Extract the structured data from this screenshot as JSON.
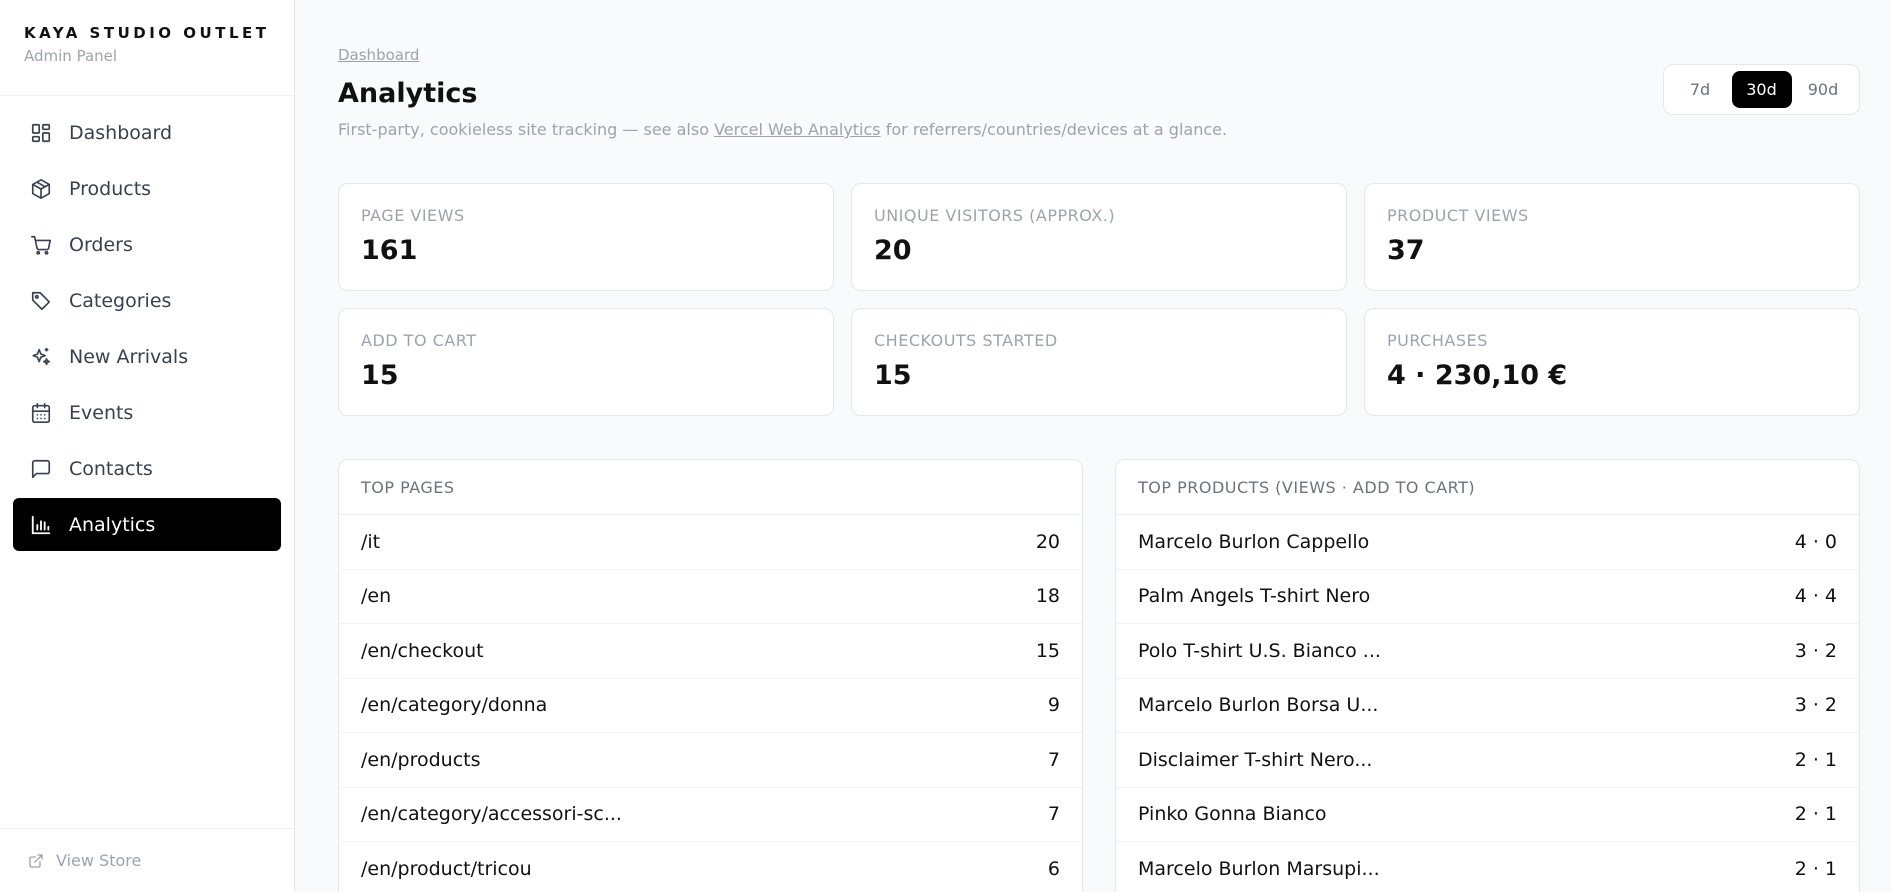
{
  "brand": {
    "title": "KAYA STUDIO OUTLET",
    "subtitle": "Admin Panel"
  },
  "nav": [
    {
      "label": "Dashboard",
      "icon": "dashboard-icon"
    },
    {
      "label": "Products",
      "icon": "box-icon"
    },
    {
      "label": "Orders",
      "icon": "cart-icon"
    },
    {
      "label": "Categories",
      "icon": "tag-icon"
    },
    {
      "label": "New Arrivals",
      "icon": "sparkles-icon"
    },
    {
      "label": "Events",
      "icon": "calendar-icon"
    },
    {
      "label": "Contacts",
      "icon": "message-icon"
    },
    {
      "label": "Analytics",
      "icon": "bar-chart-icon",
      "active": true
    }
  ],
  "footer": {
    "view_store": "View Store"
  },
  "header": {
    "breadcrumb": "Dashboard",
    "title": "Analytics",
    "subtitle_before": "First-party, cookieless site tracking — see also ",
    "subtitle_link": "Vercel Web Analytics",
    "subtitle_after": " for referrers/countries/devices at a glance."
  },
  "range": {
    "options": [
      "7d",
      "30d",
      "90d"
    ],
    "selected": "30d"
  },
  "stats": [
    {
      "label": "PAGE VIEWS",
      "value": "161"
    },
    {
      "label": "UNIQUE VISITORS (APPROX.)",
      "value": "20"
    },
    {
      "label": "PRODUCT VIEWS",
      "value": "37"
    },
    {
      "label": "ADD TO CART",
      "value": "15"
    },
    {
      "label": "CHECKOUTS STARTED",
      "value": "15"
    },
    {
      "label": "PURCHASES",
      "value": "4 · 230,10 €"
    }
  ],
  "top_pages": {
    "title": "TOP PAGES",
    "rows": [
      {
        "label": "/it",
        "value": "20"
      },
      {
        "label": "/en",
        "value": "18"
      },
      {
        "label": "/en/checkout",
        "value": "15"
      },
      {
        "label": "/en/category/donna",
        "value": "9"
      },
      {
        "label": "/en/products",
        "value": "7"
      },
      {
        "label": "/en/category/accessori-sc...",
        "value": "7"
      },
      {
        "label": "/en/product/tricou",
        "value": "6"
      }
    ]
  },
  "top_products": {
    "title": "TOP PRODUCTS (VIEWS · ADD TO CART)",
    "rows": [
      {
        "label": "Marcelo Burlon Cappello",
        "value": "4 · 0"
      },
      {
        "label": "Palm Angels T-shirt Nero",
        "value": "4 · 4"
      },
      {
        "label": "Polo T-shirt U.S. Bianco ...",
        "value": "3 · 2"
      },
      {
        "label": "Marcelo Burlon Borsa U...",
        "value": "3 · 2"
      },
      {
        "label": "Disclaimer T-shirt Nero...",
        "value": "2 · 1"
      },
      {
        "label": "Pinko Gonna Bianco",
        "value": "2 · 1"
      },
      {
        "label": "Marcelo Burlon Marsupi...",
        "value": "2 · 1"
      }
    ]
  }
}
